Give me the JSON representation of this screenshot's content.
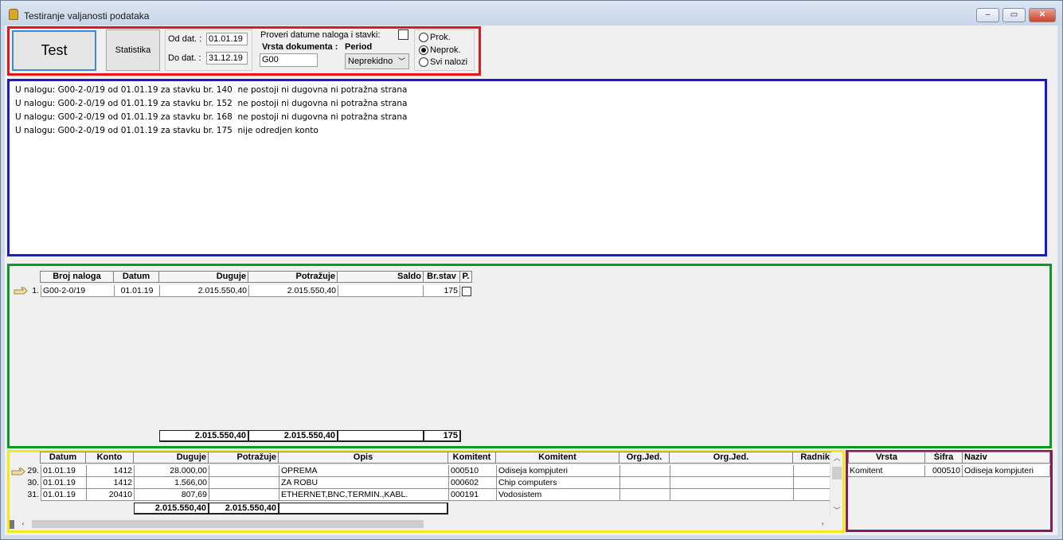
{
  "window": {
    "title": "Testiranje valjanosti podataka",
    "controls": {
      "minimize": "–",
      "restore": "▭",
      "close": "✕"
    }
  },
  "toolbar": {
    "test_label": "Test",
    "statistika_label": "Statistika",
    "od_dat_label": "Od dat. :",
    "od_dat_value": "01.01.19",
    "do_dat_label": "Do dat. :",
    "do_dat_value": "31.12.19",
    "proveri_label": "Proveri datume naloga i stavki:",
    "vrsta_label": "Vrsta dokumenta :",
    "vrsta_value": "G00",
    "period_label": "Period",
    "period_value": "Neprekidno",
    "radio_options": [
      "Prok.",
      "Neprok.",
      "Svi nalozi"
    ],
    "radio_selected": "Neprok."
  },
  "log": [
    "U nalogu: G00-2-0/19 od 01.01.19 za stavku br. 140  ne postoji ni dugovna ni potražna strana",
    "U nalogu: G00-2-0/19 od 01.01.19 za stavku br. 152  ne postoji ni dugovna ni potražna strana",
    "U nalogu: G00-2-0/19 od 01.01.19 za stavku br. 168  ne postoji ni dugovna ni potražna strana",
    "U nalogu: G00-2-0/19 od 01.01.19 za stavku br. 175  nije odredjen konto"
  ],
  "orders_grid": {
    "columns": [
      "Broj naloga",
      "Datum",
      "Duguje",
      "Potražuje",
      "Saldo",
      "Br.stav",
      "P."
    ],
    "rows": [
      {
        "num": "1.",
        "broj": "G00-2-0/19",
        "datum": "01.01.19",
        "duguje": "2.015.550,40",
        "potrazuje": "2.015.550,40",
        "saldo": "",
        "brstav": "175"
      }
    ],
    "totals": {
      "duguje": "2.015.550,40",
      "potrazuje": "2.015.550,40",
      "saldo": "",
      "brstav": "175"
    }
  },
  "items_grid": {
    "columns": [
      "Datum",
      "Konto",
      "Duguje",
      "Potražuje",
      "Opis",
      "Komitent",
      "Komitent",
      "Org.Jed.",
      "Org.Jed.",
      "Radnik"
    ],
    "rows": [
      {
        "num": "29.",
        "datum": "01.01.19",
        "konto": "1412",
        "duguje": "28.000,00",
        "potrazuje": "",
        "opis": "OPREMA",
        "sifra": "000510",
        "komitent": "Odiseja kompjuteri"
      },
      {
        "num": "30.",
        "datum": "01.01.19",
        "konto": "1412",
        "duguje": "1.566,00",
        "potrazuje": "",
        "opis": "ZA ROBU",
        "sifra": "000602",
        "komitent": "Chip computers"
      },
      {
        "num": "31.",
        "datum": "01.01.19",
        "konto": "20410",
        "duguje": "807,69",
        "potrazuje": "",
        "opis": "ETHERNET,BNC,TERMIN.,KABL.",
        "sifra": "000191",
        "komitent": "Vodosistem"
      }
    ],
    "totals": {
      "duguje": "2.015.550,40",
      "potrazuje": "2.015.550,40"
    }
  },
  "side_grid": {
    "columns": [
      "Vrsta",
      "Šifra",
      "Naziv"
    ],
    "rows": [
      {
        "vrsta": "Komitent",
        "sifra": "000510",
        "naziv": "Odiseja kompjuteri"
      }
    ]
  },
  "colors": {
    "frame_red": "#e8151d",
    "frame_blue": "#1a1ad6",
    "frame_green": "#0a9a20",
    "frame_yellow": "#f2ea18",
    "frame_purple": "#8a1a5a"
  }
}
